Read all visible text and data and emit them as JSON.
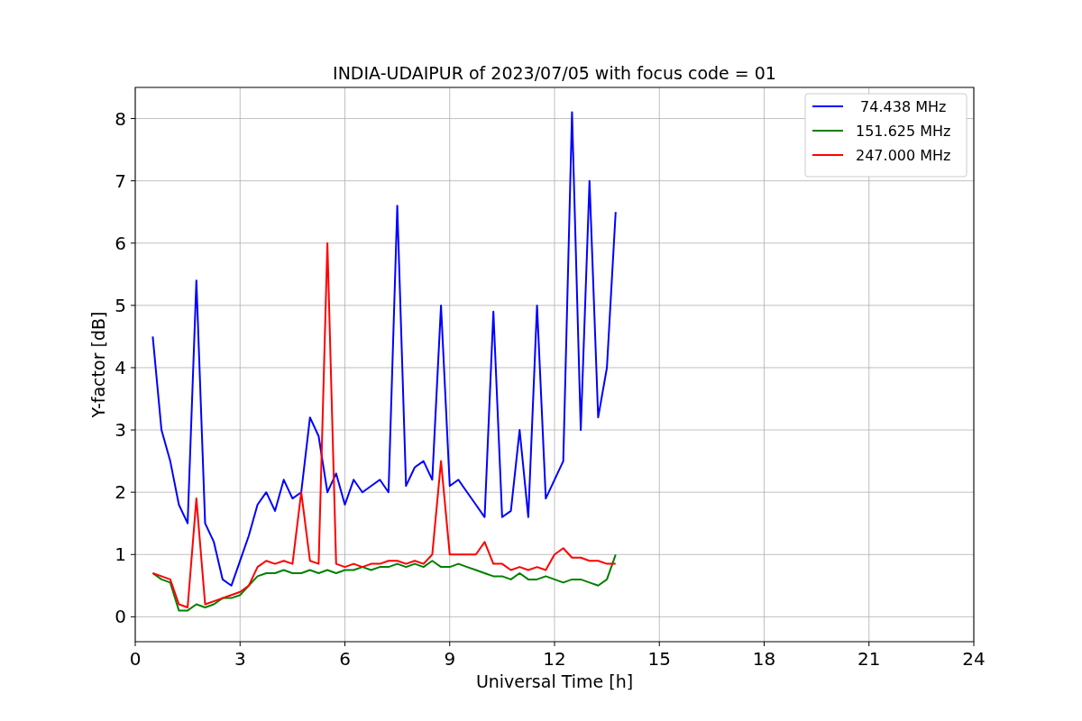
{
  "chart_data": {
    "type": "line",
    "title": "INDIA-UDAIPUR of 2023/07/05 with focus code = 01",
    "xlabel": "Universal Time [h]",
    "ylabel": "Y-factor [dB]",
    "x": [
      0.5,
      0.75,
      1,
      1.25,
      1.5,
      1.75,
      2,
      2.25,
      2.5,
      2.75,
      3,
      3.25,
      3.5,
      3.75,
      4,
      4.25,
      4.5,
      4.75,
      5,
      5.25,
      5.5,
      5.75,
      6,
      6.25,
      6.5,
      6.75,
      7,
      7.25,
      7.5,
      7.75,
      8,
      8.25,
      8.5,
      8.75,
      9,
      9.25,
      9.5,
      9.75,
      10,
      10.25,
      10.5,
      10.75,
      11,
      11.25,
      11.5,
      11.75,
      12,
      12.25,
      12.5,
      12.75,
      13,
      13.25,
      13.5,
      13.75
    ],
    "series": [
      {
        "name": " 74.438 MHz",
        "color": "#0000ff",
        "values": [
          4.5,
          3.0,
          2.5,
          1.8,
          1.5,
          5.4,
          1.5,
          1.2,
          0.6,
          0.5,
          0.9,
          1.3,
          1.8,
          2.0,
          1.7,
          2.2,
          1.9,
          2.0,
          3.2,
          2.9,
          2.0,
          2.3,
          1.8,
          2.2,
          2.0,
          2.1,
          2.2,
          2.0,
          6.6,
          2.1,
          2.4,
          2.5,
          2.2,
          5.0,
          2.1,
          2.2,
          2.0,
          1.8,
          1.6,
          4.9,
          1.6,
          1.7,
          3.0,
          1.6,
          5.0,
          1.9,
          2.2,
          2.5,
          8.1,
          3.0,
          7.0,
          3.2,
          4.0,
          6.5
        ]
      },
      {
        "name": "151.625 MHz",
        "color": "#008000",
        "values": [
          0.7,
          0.6,
          0.55,
          0.1,
          0.1,
          0.2,
          0.15,
          0.2,
          0.3,
          0.3,
          0.35,
          0.5,
          0.65,
          0.7,
          0.7,
          0.75,
          0.7,
          0.7,
          0.75,
          0.7,
          0.75,
          0.7,
          0.75,
          0.75,
          0.8,
          0.75,
          0.8,
          0.8,
          0.85,
          0.8,
          0.85,
          0.8,
          0.9,
          0.8,
          0.8,
          0.85,
          0.8,
          0.75,
          0.7,
          0.65,
          0.65,
          0.6,
          0.7,
          0.6,
          0.6,
          0.65,
          0.6,
          0.55,
          0.6,
          0.6,
          0.55,
          0.5,
          0.6,
          1.0
        ]
      },
      {
        "name": "247.000 MHz",
        "color": "#ff0000",
        "values": [
          0.7,
          0.65,
          0.6,
          0.2,
          0.15,
          1.9,
          0.2,
          0.25,
          0.3,
          0.35,
          0.4,
          0.5,
          0.8,
          0.9,
          0.85,
          0.9,
          0.85,
          2.0,
          0.9,
          0.85,
          6.0,
          0.85,
          0.8,
          0.85,
          0.8,
          0.85,
          0.85,
          0.9,
          0.9,
          0.85,
          0.9,
          0.85,
          1.0,
          2.5,
          1.0,
          1.0,
          1.0,
          1.0,
          1.2,
          0.85,
          0.85,
          0.75,
          0.8,
          0.75,
          0.8,
          0.75,
          1.0,
          1.1,
          0.95,
          0.95,
          0.9,
          0.9,
          0.85,
          0.85
        ]
      }
    ],
    "xlim": [
      0,
      24
    ],
    "ylim": [
      -0.4,
      8.5
    ],
    "xticks": [
      0,
      3,
      6,
      9,
      12,
      15,
      18,
      21,
      24
    ],
    "yticks": [
      0,
      1,
      2,
      3,
      4,
      5,
      6,
      7,
      8
    ],
    "grid": true,
    "legend": true
  }
}
